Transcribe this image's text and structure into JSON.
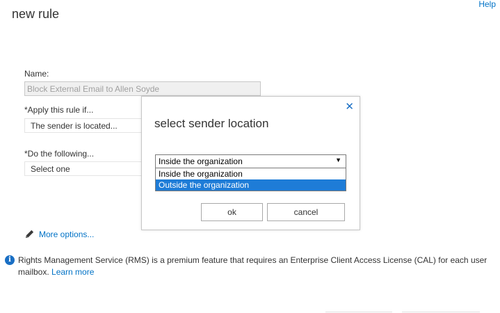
{
  "page": {
    "title": "new rule",
    "help_link": "Help"
  },
  "form": {
    "name_label": "Name:",
    "name_value": "Block External Email to Allen Soyde",
    "apply_label": "*Apply this rule if...",
    "apply_value": "The sender is located...",
    "do_label": "*Do the following...",
    "do_value": "Select one",
    "more_options": "More options...",
    "pencil_icon": "pencil-icon"
  },
  "info": {
    "icon": "info-icon",
    "icon_glyph": "i",
    "text": "Rights Management Service (RMS) is a premium feature that requires an Enterprise Client Access License (CAL) for each user mailbox.",
    "learn_more": "Learn more"
  },
  "dialog": {
    "title": "select sender location",
    "close_glyph": "✕",
    "selected_value": "Inside the organization",
    "caret_glyph": "▼",
    "options": [
      {
        "label": "Inside the organization",
        "highlighted": false
      },
      {
        "label": "Outside the organization",
        "highlighted": true
      }
    ],
    "ok_label": "ok",
    "cancel_label": "cancel"
  },
  "colors": {
    "link": "#0072c6",
    "highlight": "#1e7cd7",
    "info_icon": "#1a6fc4"
  }
}
